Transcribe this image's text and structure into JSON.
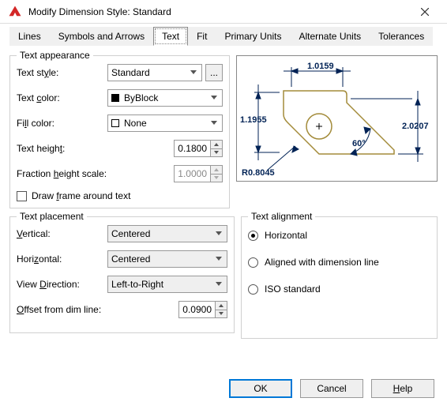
{
  "window": {
    "title": "Modify Dimension Style: Standard"
  },
  "tabs": {
    "items": [
      "Lines",
      "Symbols and Arrows",
      "Text",
      "Fit",
      "Primary Units",
      "Alternate Units",
      "Tolerances"
    ],
    "active": 2
  },
  "appearance": {
    "legend": "Text appearance",
    "style_label": "Text style:",
    "style_value": "Standard",
    "color_label": "Text color:",
    "color_value": "ByBlock",
    "fill_label": "Fill color:",
    "fill_value": "None",
    "height_label": "Text height:",
    "height_value": "0.1800",
    "fraction_label": "Fraction height scale:",
    "fraction_value": "1.0000",
    "frame_label": "Draw frame around text"
  },
  "placement": {
    "legend": "Text placement",
    "vertical_label": "Vertical:",
    "vertical_value": "Centered",
    "horizontal_label": "Horizontal:",
    "horizontal_value": "Centered",
    "direction_label": "View Direction:",
    "direction_value": "Left-to-Right",
    "offset_label": "Offset from dim line:",
    "offset_value": "0.0900"
  },
  "alignment": {
    "legend": "Text alignment",
    "horizontal": "Horizontal",
    "aligned": "Aligned with dimension line",
    "iso": "ISO standard",
    "selected": "horizontal"
  },
  "preview": {
    "dims": {
      "top": "1.0159",
      "left": "1.1955",
      "right": "2.0207",
      "radius": "R0.8045",
      "angle": "60°"
    }
  },
  "buttons": {
    "ok": "OK",
    "cancel": "Cancel",
    "help": "Help"
  }
}
